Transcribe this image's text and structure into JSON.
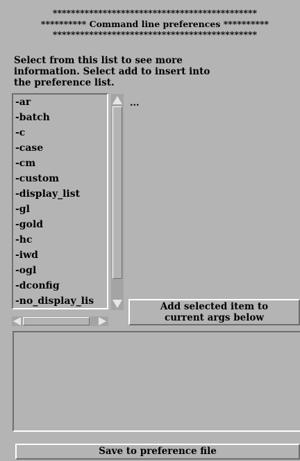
{
  "header": {
    "line1": "*********************************************",
    "line2": "********** Command line preferences **********",
    "line3": "*********************************************"
  },
  "instructions": "Select from this list to see more information. Select add to insert into the preference list.",
  "options_list": {
    "items": [
      "-ar",
      "-batch",
      "-c",
      "-case",
      "-cm",
      "-custom",
      "-display_list",
      "-gl",
      "-gold",
      "-hc",
      "-iwd",
      "-ogl",
      "-dconfig",
      "-no_display_lis"
    ]
  },
  "info_text": "...",
  "add_button": {
    "line1": "Add selected item to",
    "line2": "current args below"
  },
  "current_args": {
    "value": ""
  },
  "save_button": {
    "label": "Save to preference file"
  }
}
